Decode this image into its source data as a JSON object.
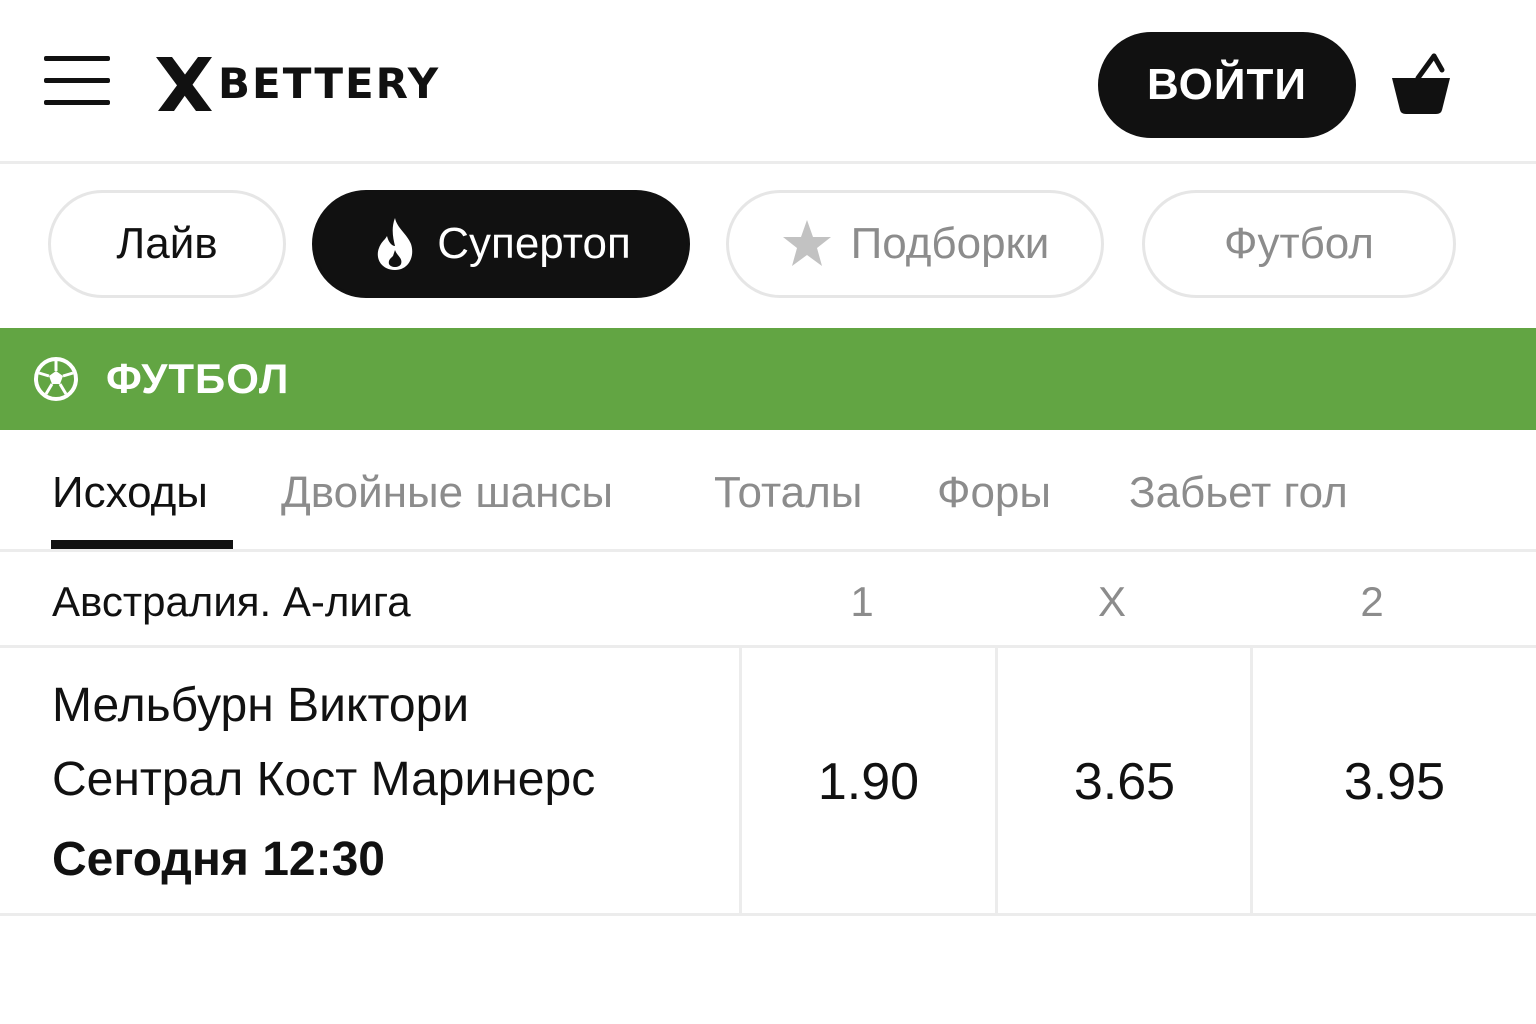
{
  "header": {
    "menu_icon": "hamburger-menu-icon",
    "logo_x": "X",
    "logo_text": "BETTERY",
    "login_label": "ВОЙТИ",
    "basket_icon": "basket-icon"
  },
  "chips": {
    "live": "Лайв",
    "supertop": "Супертоп",
    "supertop_icon": "fire-icon",
    "podborki": "Подборки",
    "podborki_icon": "star-icon",
    "football": "Футбол"
  },
  "sport": {
    "icon": "soccer-ball-icon",
    "title": "ФУТБОЛ",
    "color": "#62a543"
  },
  "tabs": [
    "Исходы",
    "Двойные шансы",
    "Тоталы",
    "Форы",
    "Забьет гол"
  ],
  "active_tab": "Исходы",
  "league": {
    "name": "Австралия. А-лига",
    "columns": [
      "1",
      "X",
      "2"
    ]
  },
  "match": {
    "home": "Мельбурн Виктори",
    "away": "Сентрал Кост Маринерс",
    "time": "Сегодня 12:30",
    "odds": [
      "1.90",
      "3.65",
      "3.95"
    ]
  }
}
